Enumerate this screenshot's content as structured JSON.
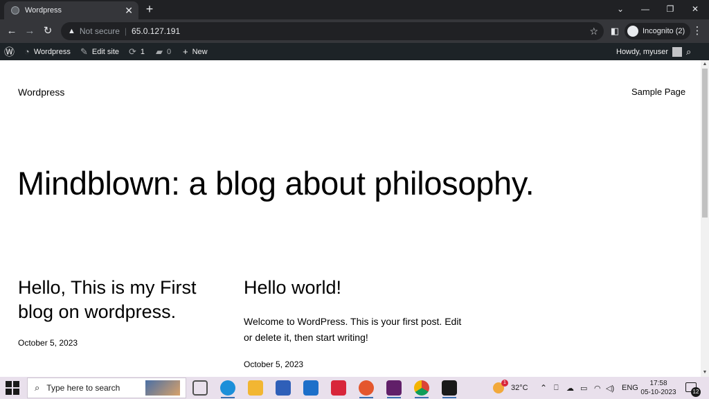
{
  "browser": {
    "tab_title": "Wordpress",
    "tab_close": "✕",
    "new_tab": "+",
    "not_secure": "Not secure",
    "url": "65.0.127.191",
    "incognito_label": "Incognito (2)"
  },
  "admin_bar": {
    "site_name": "Wordpress",
    "edit_site": "Edit site",
    "updates_count": "1",
    "comments_count": "0",
    "new_label": "New",
    "greeting": "Howdy, myuser"
  },
  "site": {
    "title": "Wordpress",
    "nav_sample_page": "Sample Page",
    "hero_heading": "Mindblown: a blog about philosophy."
  },
  "posts": [
    {
      "title": "Hello, This is my First blog on wordpress.",
      "date": "October 5, 2023"
    },
    {
      "title": "Hello world!",
      "excerpt": "Welcome to WordPress. This is your first post. Edit or delete it, then start writing!",
      "date": "October 5, 2023"
    }
  ],
  "taskbar": {
    "search_placeholder": "Type here to search",
    "weather_temp": "32°C",
    "weather_badge": "1",
    "language": "ENG",
    "time": "17:58",
    "date": "05-10-2023",
    "notification_count": "12"
  },
  "colors": {
    "browser_dark": "#202124",
    "browser_toolbar": "#35363a",
    "admin_bar": "#1d2327",
    "taskbar": "#e9e0ec"
  }
}
